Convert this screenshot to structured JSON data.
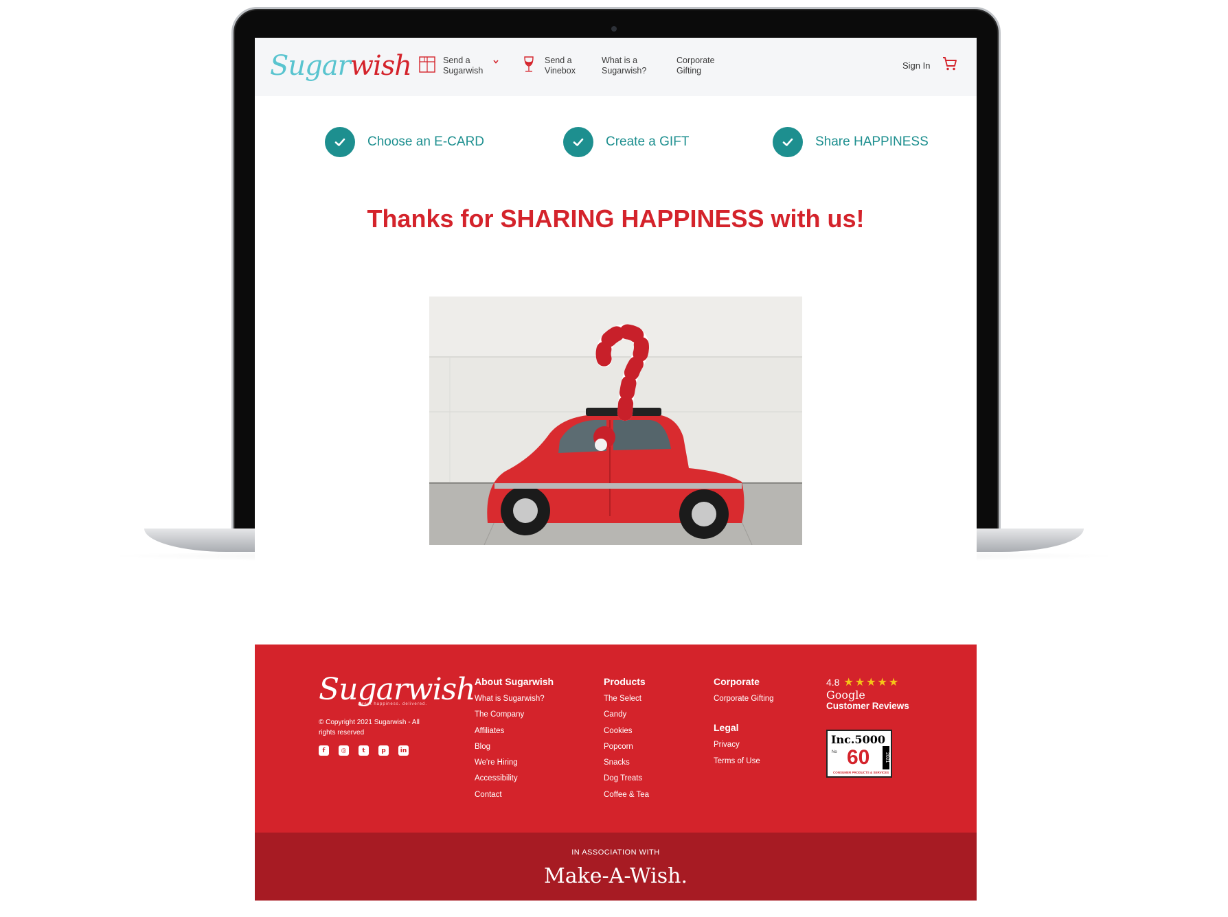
{
  "header": {
    "logo_sugar": "Sugar",
    "logo_wish": "wish",
    "nav": [
      {
        "label": "Send a\nSugarwish",
        "icon": "gift-icon"
      },
      {
        "label": "Send a\nVinebox",
        "icon": "wine-glass-icon"
      },
      {
        "label": "What is a\nSugarwish?"
      },
      {
        "label": "Corporate\nGifting"
      }
    ],
    "sign_in": "Sign In",
    "cart_icon": "cart-icon"
  },
  "steps": [
    {
      "label": "Choose an E-CARD"
    },
    {
      "label": "Create a GIFT"
    },
    {
      "label": "Share HAPPINESS"
    }
  ],
  "main": {
    "thanks_heading": "Thanks for SHARING HAPPINESS with us!"
  },
  "footer": {
    "logo": "Sugarwish",
    "tagline": "sweet happiness. delivered.",
    "copyright": "© Copyright 2021 Sugarwish - All rights reserved",
    "social": [
      "facebook-icon",
      "instagram-icon",
      "twitter-icon",
      "pinterest-icon",
      "linkedin-icon"
    ],
    "about": {
      "heading": "About Sugarwish",
      "links": [
        "What is Sugarwish?",
        "The Company",
        "Affiliates",
        "Blog",
        "We're Hiring",
        "Accessibility",
        "Contact"
      ]
    },
    "products": {
      "heading": "Products",
      "links": [
        "The Select",
        "Candy",
        "Cookies",
        "Popcorn",
        "Snacks",
        "Dog Treats",
        "Coffee & Tea"
      ]
    },
    "corporate": {
      "heading": "Corporate",
      "links": [
        "Corporate Gifting"
      ]
    },
    "legal": {
      "heading": "Legal",
      "links": [
        "Privacy",
        "Terms of Use"
      ]
    },
    "rating": {
      "value": "4.8",
      "stars": "★★★★★",
      "source": "Google",
      "label": "Customer  Reviews"
    },
    "inc": {
      "title": "Inc.5000",
      "no": "No",
      "rank": "60",
      "year": "2021",
      "category": "CONSUMER PRODUCTS & SERVICES"
    },
    "association_label": "IN ASSOCIATION WITH",
    "association_logo": "Make-A-Wish."
  },
  "colors": {
    "brand_red": "#d4232b",
    "brand_teal": "#1d8f8f",
    "logo_teal": "#59c4cf",
    "footer_dark": "#a71b23"
  }
}
